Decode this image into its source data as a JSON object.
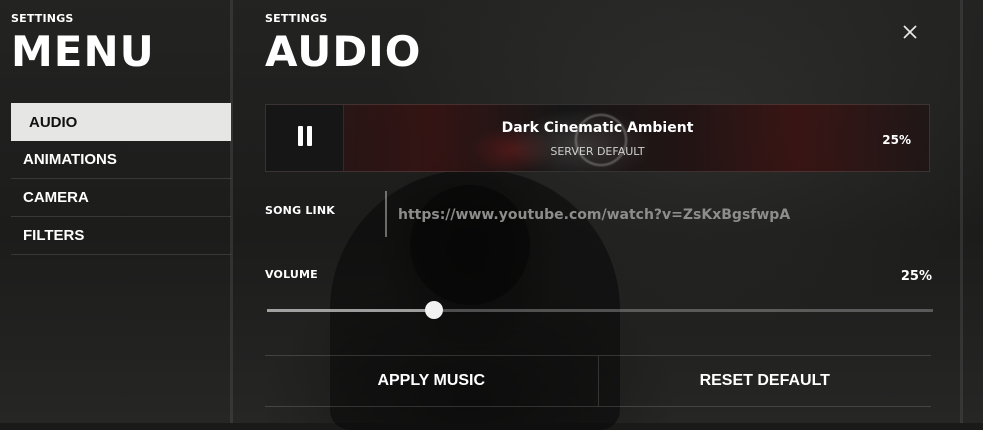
{
  "sidebar": {
    "eyebrow": "SETTINGS",
    "title": "MENU",
    "items": [
      {
        "label": "AUDIO",
        "active": true
      },
      {
        "label": "ANIMATIONS",
        "active": false
      },
      {
        "label": "CAMERA",
        "active": false
      },
      {
        "label": "FILTERS",
        "active": false
      }
    ]
  },
  "main": {
    "eyebrow": "SETTINGS",
    "title": "AUDIO",
    "close_icon": "close-icon",
    "player": {
      "state_icon": "pause-icon",
      "song_title": "Dark Cinematic Ambient",
      "song_subtitle": "SERVER DEFAULT",
      "volume_label": "25%"
    },
    "song_link": {
      "label": "SONG LINK",
      "value": "https://www.youtube.com/watch?v=ZsKxBgsfwpA"
    },
    "volume": {
      "label": "VOLUME",
      "value_label": "25%",
      "value": 0.25
    },
    "actions": {
      "apply_label": "APPLY MUSIC",
      "reset_label": "RESET DEFAULT"
    }
  },
  "colors": {
    "active_tab_bg": "#e6e6e4",
    "active_tab_text": "#111111",
    "text": "#ffffff",
    "muted_text": "#8d8d8b"
  }
}
